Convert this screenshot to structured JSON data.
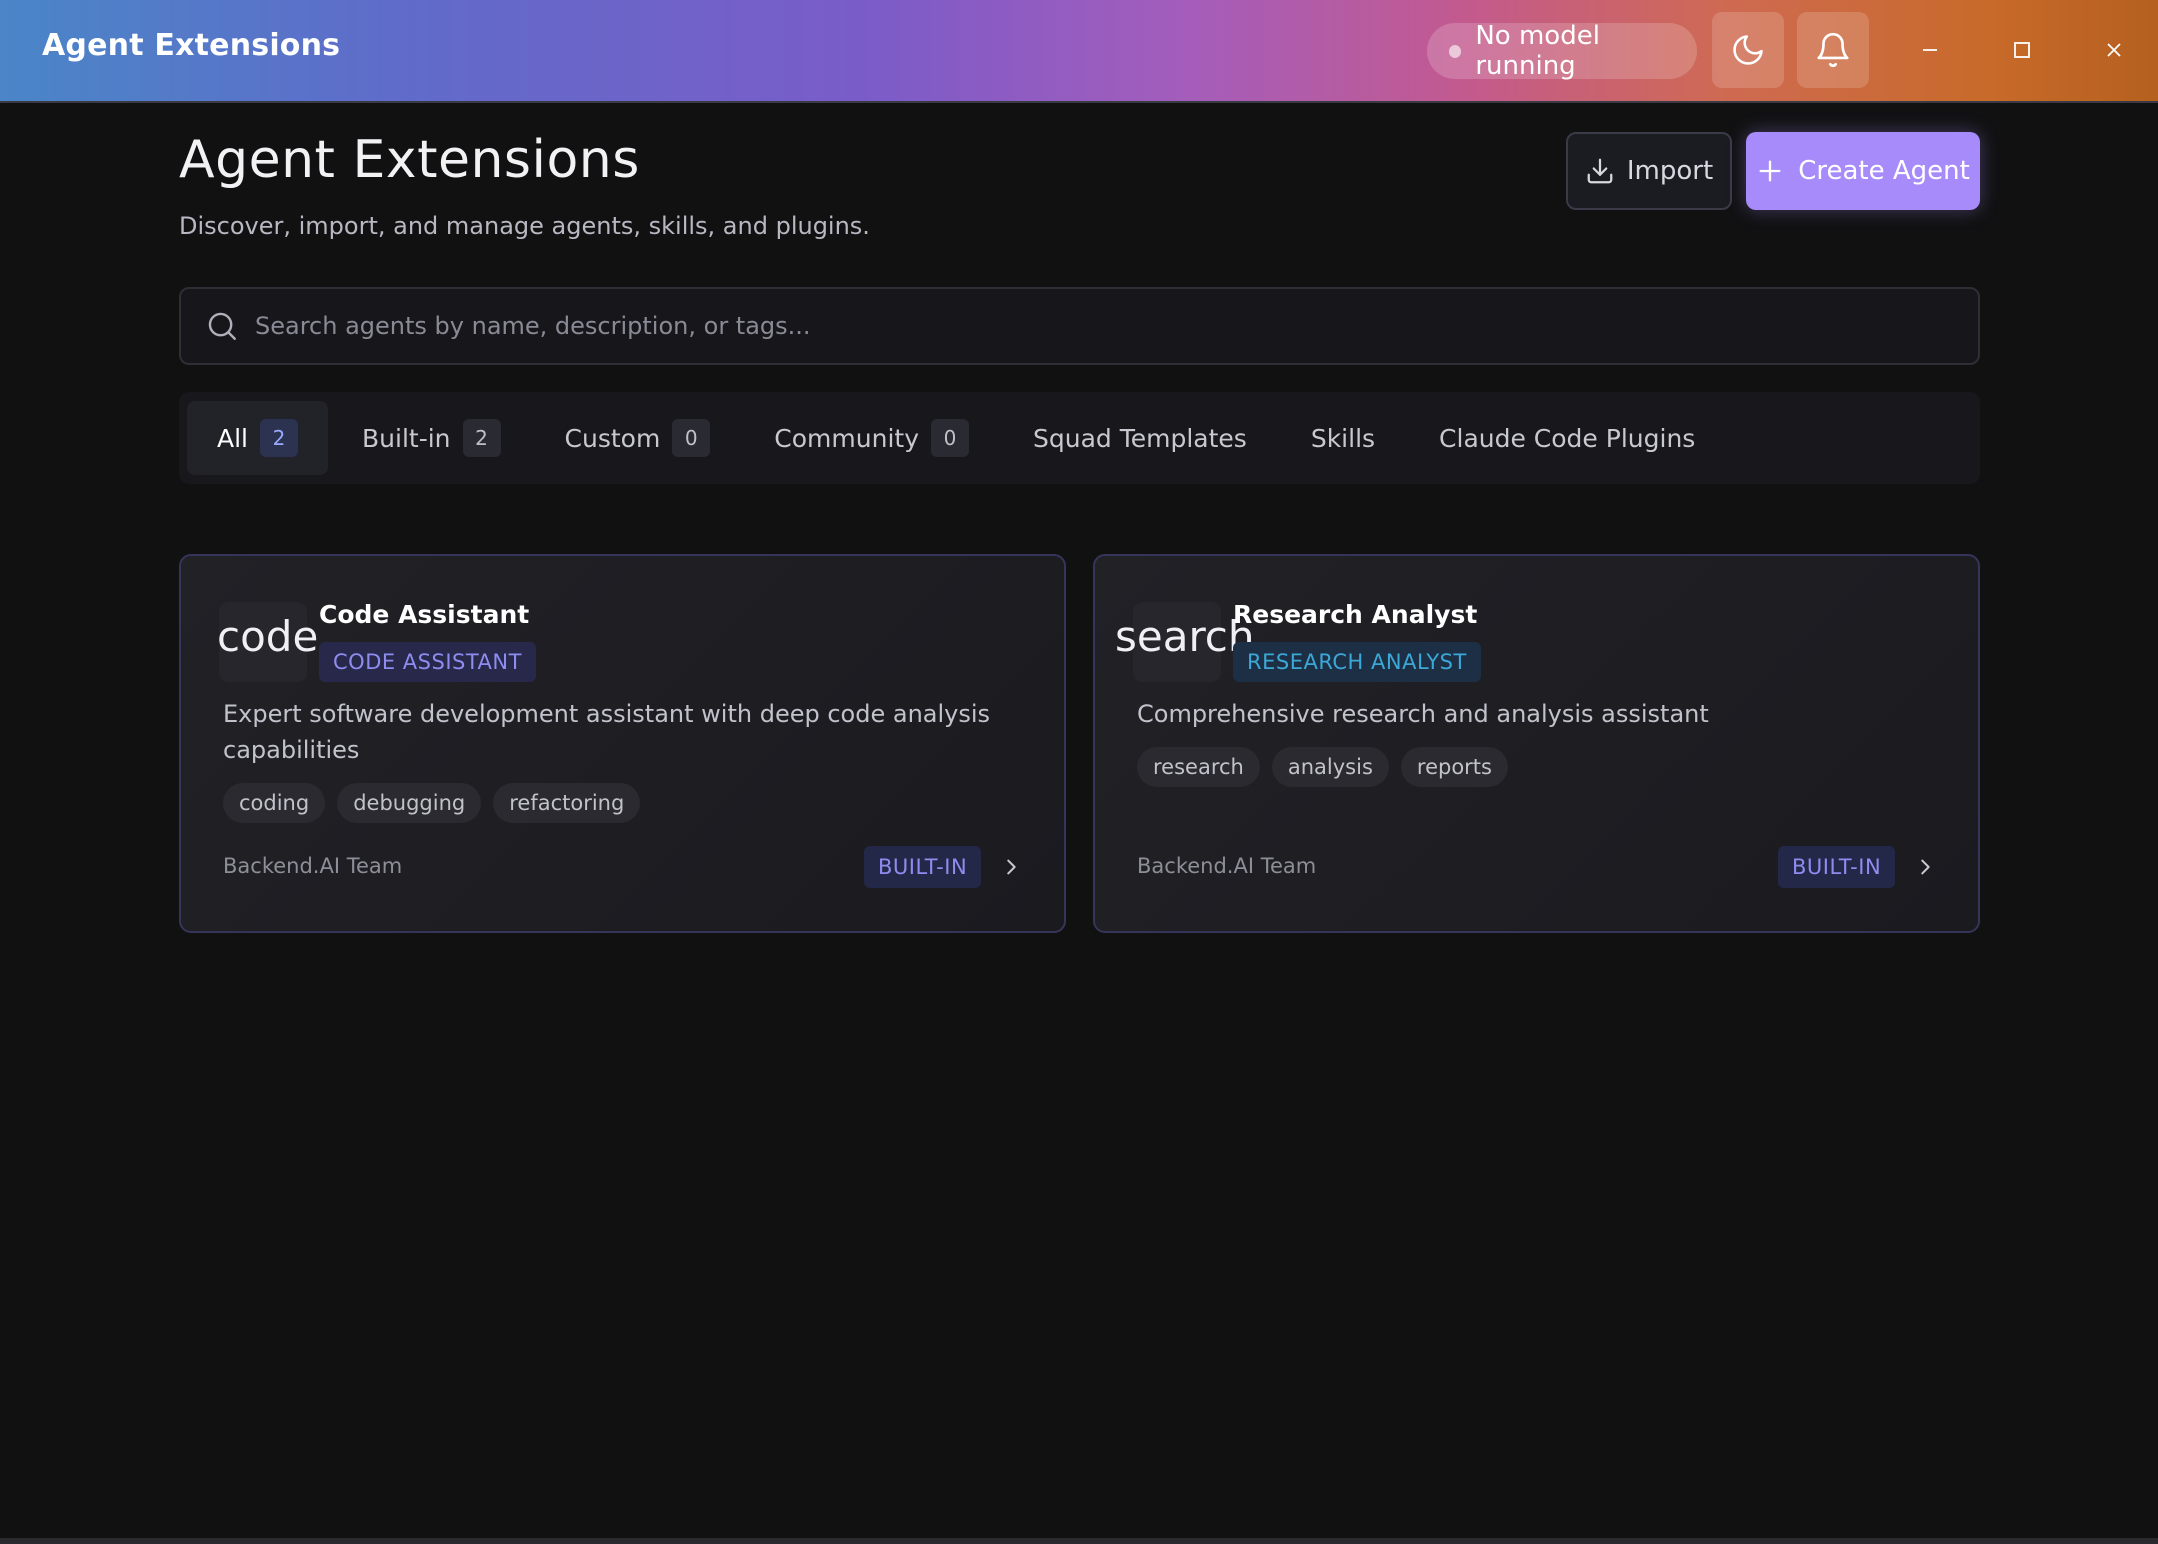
{
  "titlebar": {
    "app_title": "Agent Extensions",
    "model_status": "No model running",
    "theme_icon": "moon-icon",
    "notification_icon": "bell-icon",
    "window_controls": [
      "minimize-icon",
      "maximize-icon",
      "close-icon"
    ]
  },
  "header": {
    "title": "Agent Extensions",
    "subtitle": "Discover, import, and manage agents, skills, and plugins.",
    "import_label": "Import",
    "create_label": "Create Agent"
  },
  "search": {
    "placeholder": "Search agents by name, description, or tags...",
    "value": ""
  },
  "tabs": [
    {
      "label": "All",
      "count": "2",
      "active": true
    },
    {
      "label": "Built-in",
      "count": "2"
    },
    {
      "label": "Custom",
      "count": "0"
    },
    {
      "label": "Community",
      "count": "0"
    },
    {
      "label": "Squad Templates"
    },
    {
      "label": "Skills"
    },
    {
      "label": "Claude Code Plugins"
    }
  ],
  "cards": [
    {
      "icon_word": "code",
      "name": "Code Assistant",
      "badge": "CODE ASSISTANT",
      "description_line1": "Expert software development assistant with deep code analysis",
      "description_line2": "capabilities",
      "tags": [
        "coding",
        "debugging",
        "refactoring"
      ],
      "author": "Backend.AI Team",
      "status": "BUILT-IN"
    },
    {
      "icon_word": "search",
      "name": "Research Analyst",
      "badge": "RESEARCH ANALYST",
      "description_line1": "Comprehensive research and analysis assistant",
      "description_line2": "",
      "tags": [
        "research",
        "analysis",
        "reports"
      ],
      "author": "Backend.AI Team",
      "status": "BUILT-IN"
    }
  ],
  "colors": {
    "accent": "#a78bfa",
    "background": "#111112",
    "badge_purple": "#8f8cf0",
    "badge_blue": "#3ba8d8"
  }
}
